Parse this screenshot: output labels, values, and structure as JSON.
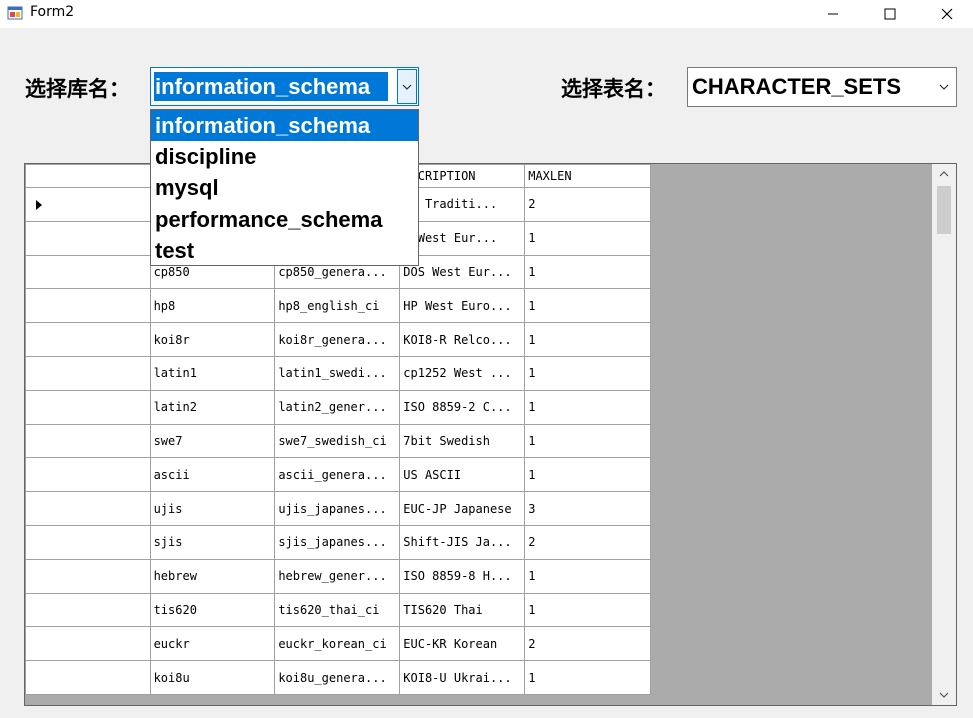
{
  "window": {
    "title": "Form2"
  },
  "labels": {
    "database": "选择库名：",
    "table": "选择表名："
  },
  "db_combo": {
    "value": "information_schema"
  },
  "table_combo": {
    "value": "CHARACTER_SETS"
  },
  "db_options": [
    "information_schema",
    "discipline",
    "mysql",
    "performance_schema",
    "test"
  ],
  "grid": {
    "columns": [
      "",
      "",
      "",
      "ESCRIPTION",
      "MAXLEN"
    ],
    "rows": [
      [
        "",
        "",
        "",
        "g5 Traditi...",
        "2"
      ],
      [
        "",
        "",
        "",
        "C West Eur...",
        "1"
      ],
      [
        "",
        "cp850",
        "cp850_genera...",
        "DOS West Eur...",
        "1"
      ],
      [
        "",
        "hp8",
        "hp8_english_ci",
        "HP West Euro...",
        "1"
      ],
      [
        "",
        "koi8r",
        "koi8r_genera...",
        "KOI8-R Relco...",
        "1"
      ],
      [
        "",
        "latin1",
        "latin1_swedi...",
        "cp1252 West ...",
        "1"
      ],
      [
        "",
        "latin2",
        "latin2_gener...",
        "ISO 8859-2 C...",
        "1"
      ],
      [
        "",
        "swe7",
        "swe7_swedish_ci",
        "7bit Swedish",
        "1"
      ],
      [
        "",
        "ascii",
        "ascii_genera...",
        "US ASCII",
        "1"
      ],
      [
        "",
        "ujis",
        "ujis_japanes...",
        "EUC-JP Japanese",
        "3"
      ],
      [
        "",
        "sjis",
        "sjis_japanes...",
        "Shift-JIS Ja...",
        "2"
      ],
      [
        "",
        "hebrew",
        "hebrew_gener...",
        "ISO 8859-8 H...",
        "1"
      ],
      [
        "",
        "tis620",
        "tis620_thai_ci",
        "TIS620 Thai",
        "1"
      ],
      [
        "",
        "euckr",
        "euckr_korean_ci",
        "EUC-KR Korean",
        "2"
      ],
      [
        "",
        "koi8u",
        "koi8u_genera...",
        "KOI8-U Ukrai...",
        "1"
      ]
    ]
  }
}
